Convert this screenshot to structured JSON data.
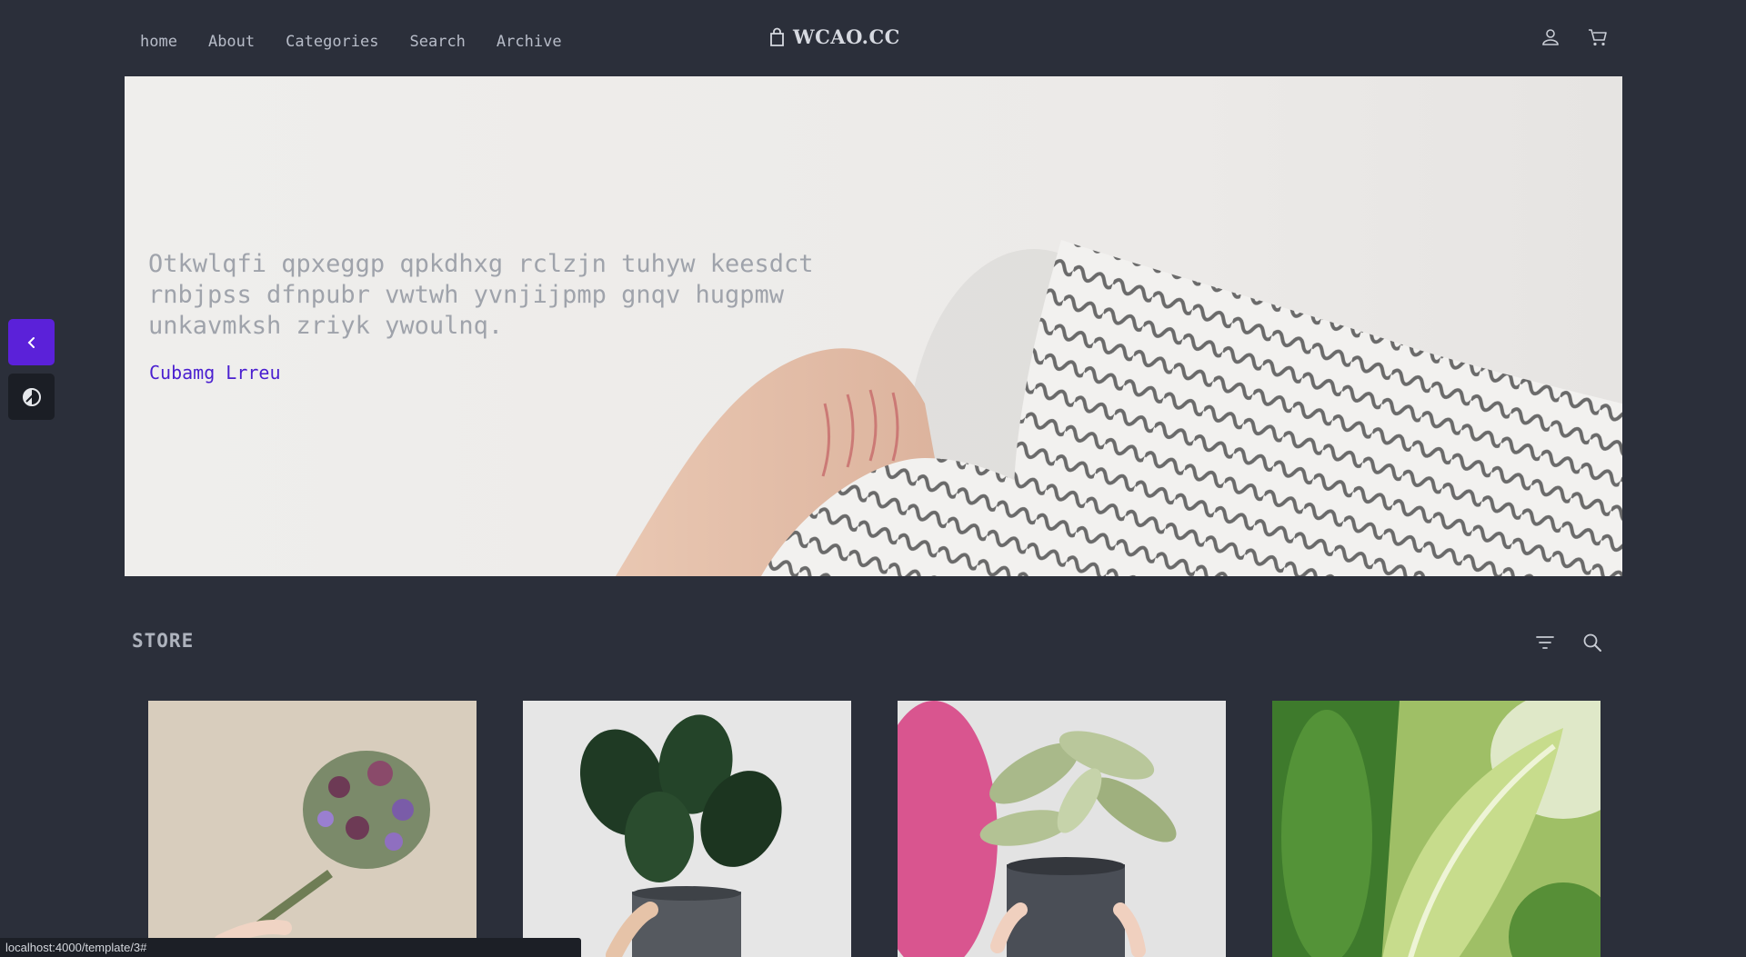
{
  "nav": {
    "items": [
      {
        "label": "home"
      },
      {
        "label": "About"
      },
      {
        "label": "Categories"
      },
      {
        "label": "Search"
      },
      {
        "label": "Archive"
      }
    ]
  },
  "brand": {
    "name": "WCAO.CC",
    "icon": "shopping-bag-icon"
  },
  "header_icons": {
    "account": "user-icon",
    "cart": "cart-icon"
  },
  "hero": {
    "text": "Otkwlqfi qpxeggp qpkdhxg rclzjn tuhyw keesdct rnbjpss dfnpubr vwtwh yvnjijpmp gnqv hugpmw unkavmksh zriyk ywoulnq.",
    "link_label": "Cubamg Lrreu"
  },
  "side_buttons": {
    "back": "chevron-left-icon",
    "theme": "theme-toggle-icon"
  },
  "store": {
    "title": "STORE",
    "tools": {
      "filter": "filter-icon",
      "search": "search-icon"
    },
    "products": [
      {
        "image": "flower-bouquet-photo"
      },
      {
        "image": "anthurium-pot-photo"
      },
      {
        "image": "aglaonema-pot-photo"
      },
      {
        "image": "dieffenbachia-leaf-photo"
      }
    ]
  },
  "status_bar": {
    "url": "localhost:4000/template/3#"
  },
  "colors": {
    "background": "#2b2f3a",
    "accent": "#5b21d9",
    "hero_link": "#4a1fd0"
  }
}
